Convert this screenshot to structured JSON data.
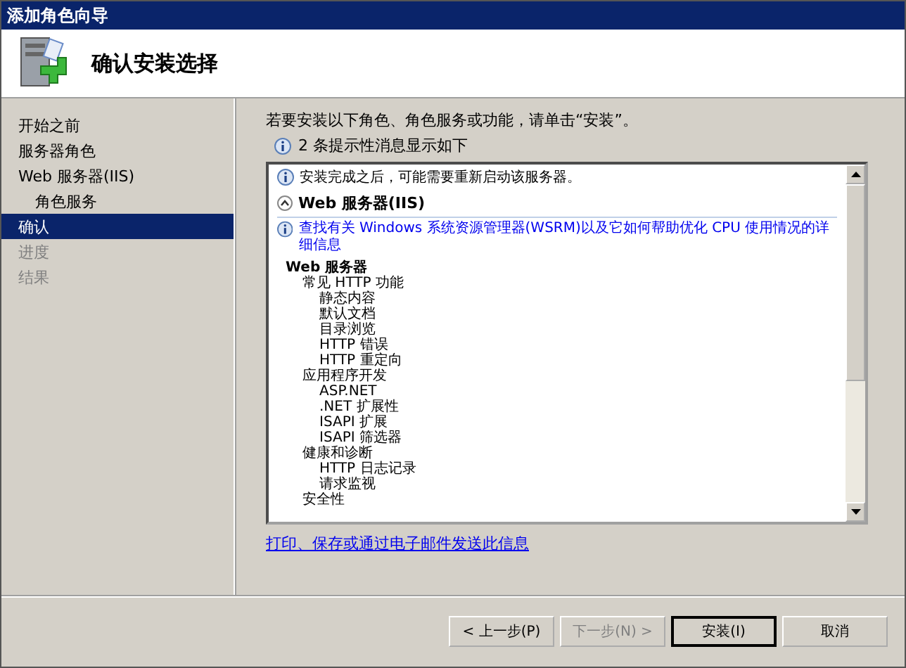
{
  "window": {
    "title": "添加角色向导"
  },
  "header": {
    "title": "确认安装选择"
  },
  "sidebar": {
    "items": [
      {
        "label": "开始之前",
        "selected": false,
        "disabled": false
      },
      {
        "label": "服务器角色",
        "selected": false,
        "disabled": false
      },
      {
        "label": "Web 服务器(IIS)",
        "selected": false,
        "disabled": false,
        "children": [
          {
            "label": "角色服务",
            "selected": false,
            "disabled": false
          }
        ]
      },
      {
        "label": "确认",
        "selected": true,
        "disabled": false
      },
      {
        "label": "进度",
        "selected": false,
        "disabled": true
      },
      {
        "label": "结果",
        "selected": false,
        "disabled": true
      }
    ]
  },
  "content": {
    "instruction": "若要安装以下角色、角色服务或功能，请单击“安装”。",
    "message_count": "2 条提示性消息显示如下",
    "details": {
      "notice": "安装完成之后，可能需要重新启动该服务器。",
      "section": {
        "title": "Web 服务器(IIS)",
        "expanded": true,
        "link": "查找有关 Windows 系统资源管理器(WSRM)以及它如何帮助优化 CPU 使用情况的详细信息",
        "tree": [
          {
            "label": "Web 服务器",
            "children": [
              {
                "label": "常见 HTTP 功能",
                "children": [
                  {
                    "label": "静态内容"
                  },
                  {
                    "label": "默认文档"
                  },
                  {
                    "label": "目录浏览"
                  },
                  {
                    "label": "HTTP 错误"
                  },
                  {
                    "label": "HTTP 重定向"
                  }
                ]
              },
              {
                "label": "应用程序开发",
                "children": [
                  {
                    "label": "ASP.NET"
                  },
                  {
                    "label": ".NET 扩展性"
                  },
                  {
                    "label": "ISAPI 扩展"
                  },
                  {
                    "label": "ISAPI 筛选器"
                  }
                ]
              },
              {
                "label": "健康和诊断",
                "children": [
                  {
                    "label": "HTTP 日志记录"
                  },
                  {
                    "label": "请求监视"
                  }
                ]
              },
              {
                "label": "安全性"
              }
            ]
          }
        ]
      }
    },
    "footer_link": "打印、保存或通过电子邮件发送此信息"
  },
  "buttons": [
    {
      "label": "< 上一步(P)",
      "disabled": false,
      "default": false
    },
    {
      "label": "下一步(N) >",
      "disabled": true,
      "default": false
    },
    {
      "label": "安装(I)",
      "disabled": false,
      "default": true
    },
    {
      "label": "取消",
      "disabled": false,
      "default": false
    }
  ]
}
